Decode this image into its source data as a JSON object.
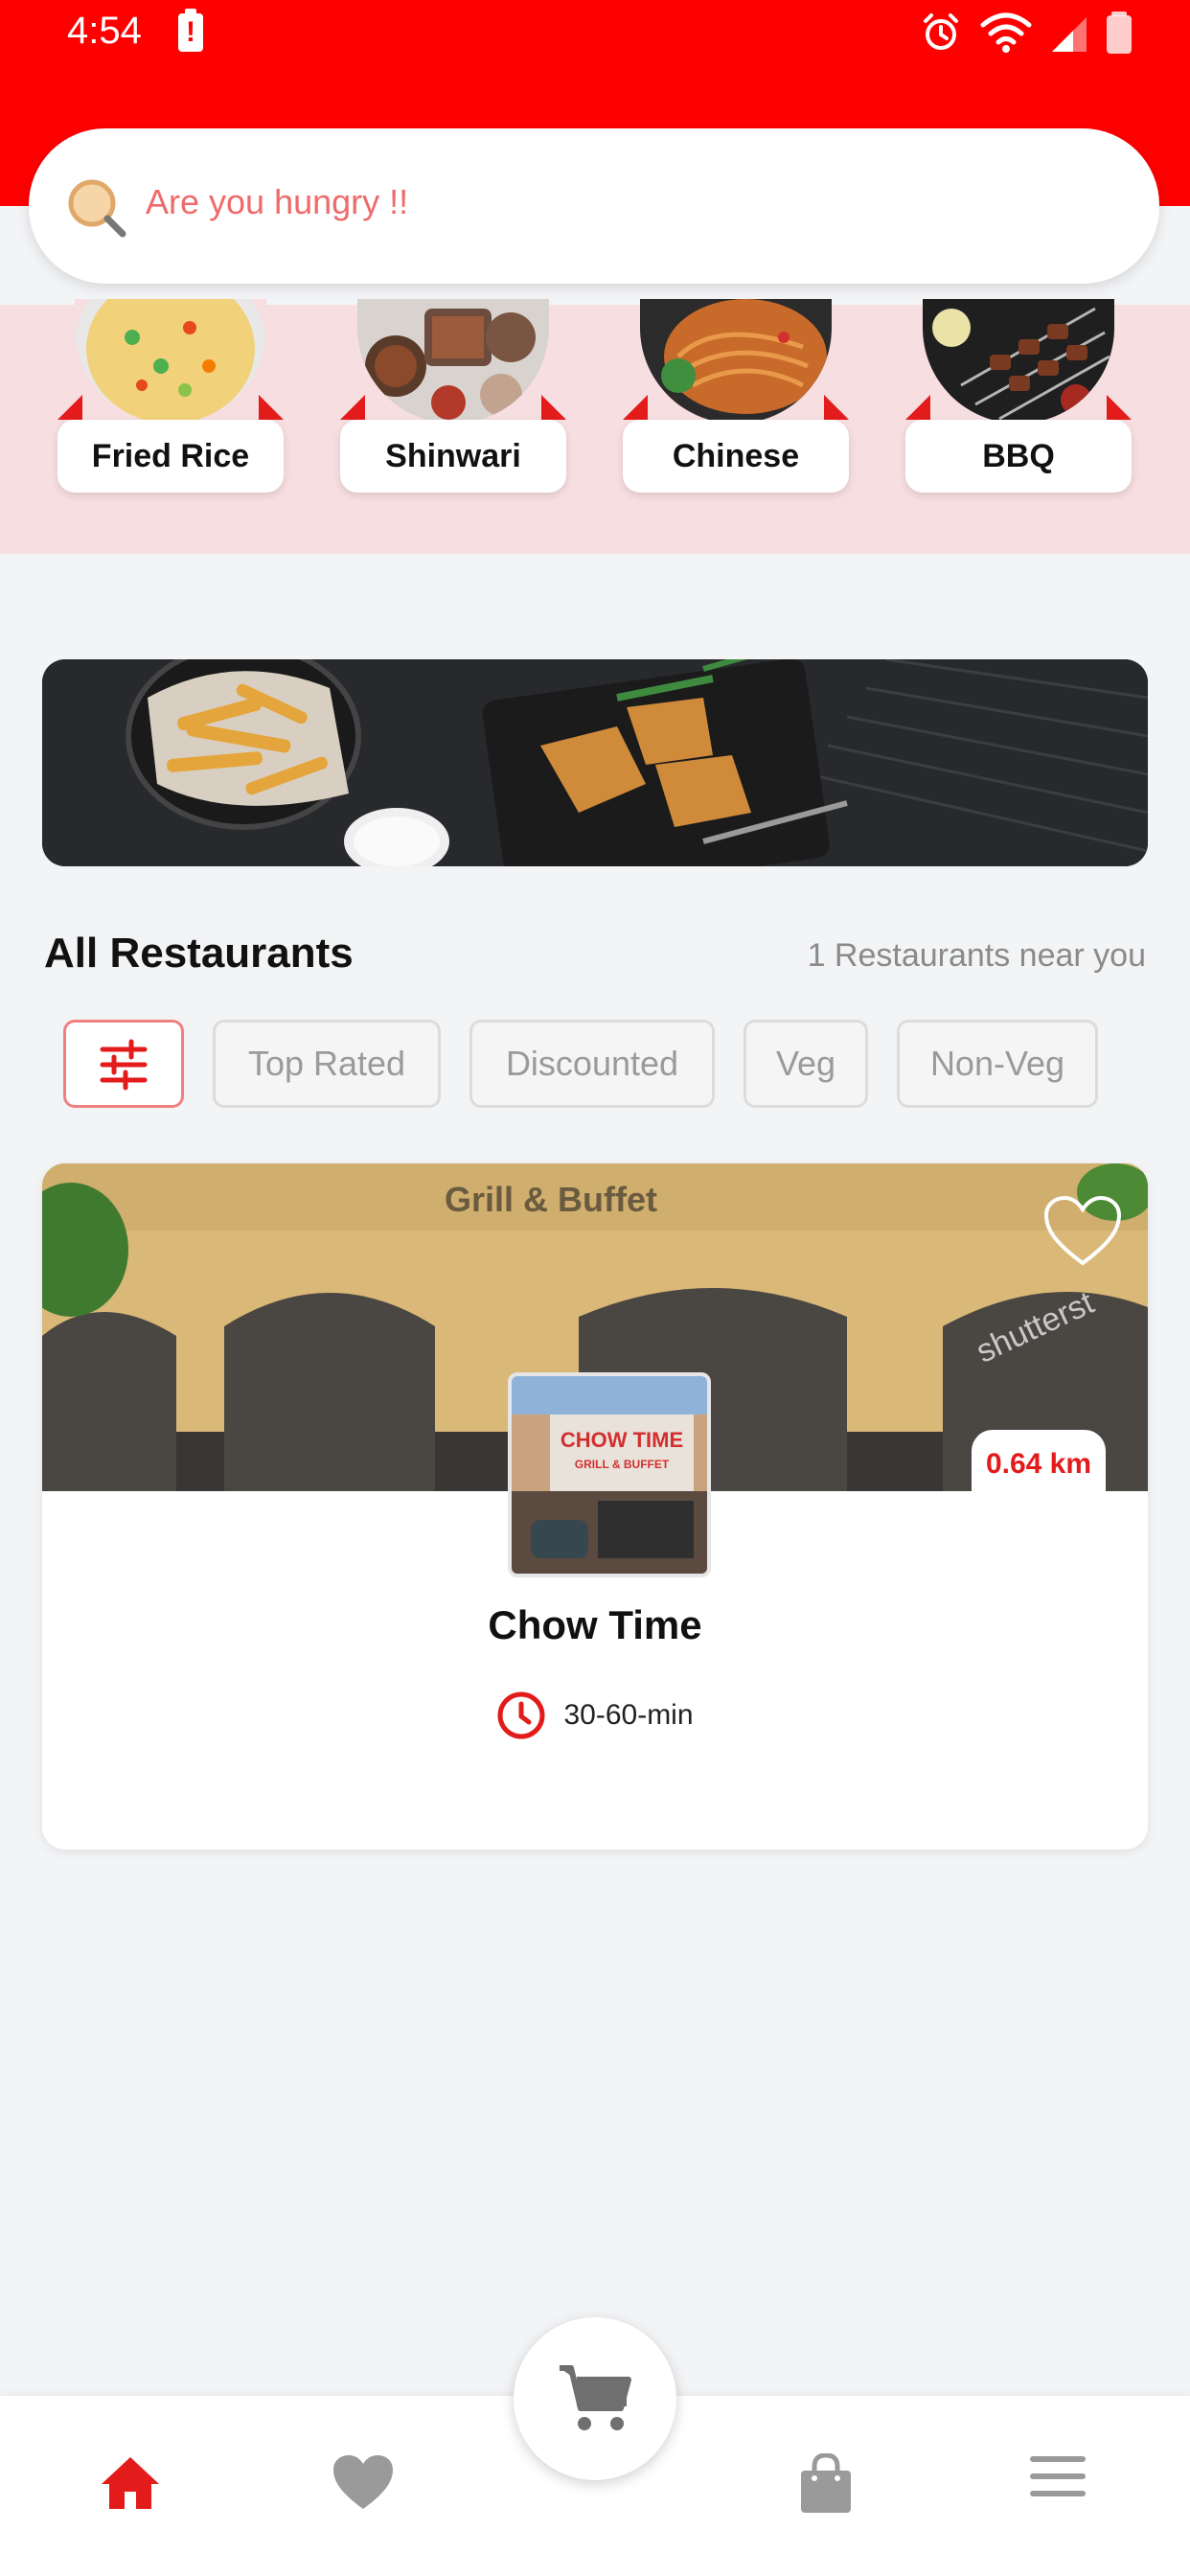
{
  "status_bar": {
    "time": "4:54",
    "alert_glyph": "!"
  },
  "search": {
    "placeholder": "Are you hungry !!"
  },
  "categories": [
    {
      "label": "Fried Rice",
      "icon": "fried-rice-image"
    },
    {
      "label": "Shinwari",
      "icon": "shinwari-image"
    },
    {
      "label": "Chinese",
      "icon": "chinese-noodles-image"
    },
    {
      "label": "BBQ",
      "icon": "bbq-skewers-image"
    }
  ],
  "section": {
    "title": "All Restaurants",
    "subtitle": "1 Restaurants near you"
  },
  "filters": [
    "Top Rated",
    "Discounted",
    "Veg",
    "Non-Veg"
  ],
  "restaurant": {
    "name": "Chow Time",
    "eta": "30-60-min",
    "distance": "0.64 km",
    "sign_text": "Grill & Buffet",
    "logo_text_1": "CHOW TIME",
    "logo_text_2": "GRILL & BUFFET",
    "watermark": "shutterst"
  },
  "colors": {
    "brand_red": "#ff0000",
    "accent_red": "#e31b1b",
    "band_pink": "#f7dee1"
  }
}
